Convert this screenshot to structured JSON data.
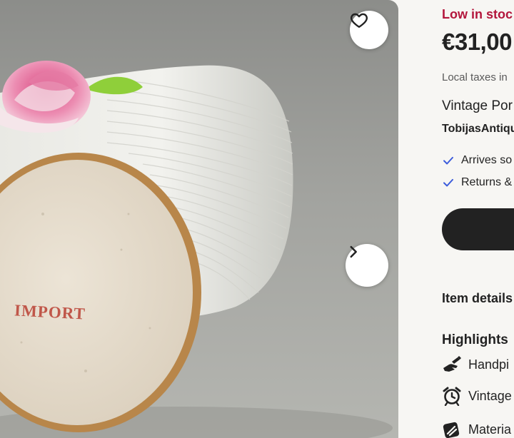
{
  "listing": {
    "stock_status": "Low in stoc",
    "price": "€31,00",
    "taxes_note": "Local taxes in",
    "title": "Vintage Por",
    "shop_name": "TobijasAntiqu",
    "benefits": [
      "Arrives so",
      "Returns &"
    ],
    "item_details_label": "Item details",
    "highlights_heading": "Highlights",
    "highlights": [
      {
        "icon": "hand-paint-icon",
        "label": "Handpi"
      },
      {
        "icon": "alarm-clock-icon",
        "label": "Vintage"
      },
      {
        "icon": "material-icon",
        "label": "Materia"
      }
    ]
  },
  "photo": {
    "stamp_text": "IMPORT",
    "favorite_icon": "heart-icon",
    "next_icon": "chevron-right-icon"
  },
  "colors": {
    "stock": "#b3163c",
    "text": "#222222",
    "check": "#3b5bdb",
    "button": "#222222",
    "background": "#f7f6f3"
  }
}
